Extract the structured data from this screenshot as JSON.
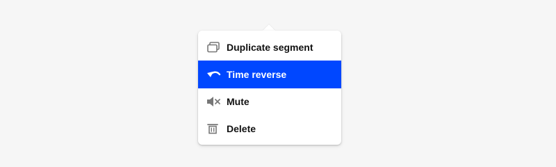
{
  "menu": {
    "items": [
      {
        "label": "Duplicate segment",
        "icon": "duplicate-icon",
        "selected": false
      },
      {
        "label": "Time reverse",
        "icon": "undo-arrow-icon",
        "selected": true
      },
      {
        "label": "Mute",
        "icon": "speaker-muted-icon",
        "selected": false
      },
      {
        "label": "Delete",
        "icon": "trash-icon",
        "selected": false
      }
    ]
  },
  "colors": {
    "background": "#f6f6f6",
    "menu_bg": "#ffffff",
    "selected_bg": "#0047ff",
    "text": "#111111",
    "icon": "#777777"
  }
}
